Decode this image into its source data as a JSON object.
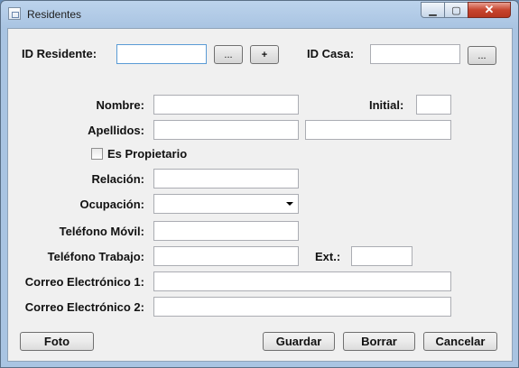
{
  "window": {
    "title": "Residentes",
    "min_glyph": "▁",
    "max_glyph": "▢",
    "close_glyph": "✕"
  },
  "form": {
    "id_residente": {
      "label": "ID Residente:",
      "value": "",
      "browse_label": "...",
      "add_label": "+"
    },
    "id_casa": {
      "label": "ID Casa:",
      "value": "",
      "browse_label": "..."
    },
    "nombre": {
      "label": "Nombre:",
      "value": ""
    },
    "initial": {
      "label": "Initial:",
      "value": ""
    },
    "apellidos": {
      "label": "Apellidos:",
      "value1": "",
      "value2": ""
    },
    "es_propietario": {
      "label": "Es Propietario",
      "checked": false
    },
    "relacion": {
      "label": "Relación:",
      "value": ""
    },
    "ocupacion": {
      "label": "Ocupación:",
      "value": ""
    },
    "telefono_movil": {
      "label": "Teléfono Móvil:",
      "value": ""
    },
    "telefono_trabajo": {
      "label": "Teléfono Trabajo:",
      "value": ""
    },
    "ext": {
      "label": "Ext.:",
      "value": ""
    },
    "correo1": {
      "label": "Correo Electrónico 1:",
      "value": ""
    },
    "correo2": {
      "label": "Correo Electrónico 2:",
      "value": ""
    }
  },
  "buttons": {
    "foto": "Foto",
    "guardar": "Guardar",
    "borrar": "Borrar",
    "cancelar": "Cancelar"
  }
}
